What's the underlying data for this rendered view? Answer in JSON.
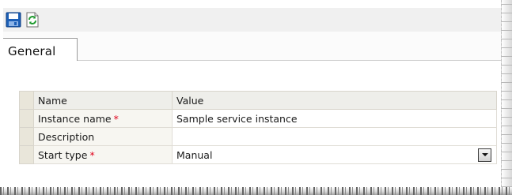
{
  "toolbar": {
    "buttons": [
      {
        "icon": "save-icon"
      },
      {
        "icon": "refresh-icon"
      }
    ]
  },
  "tabs": [
    {
      "label": "General",
      "selected": true
    }
  ],
  "grid": {
    "headers": {
      "name": "Name",
      "value": "Value"
    },
    "rows": [
      {
        "name": "Instance name",
        "required": true,
        "value": "Sample service instance"
      },
      {
        "name": "Description",
        "required": false,
        "value": ""
      },
      {
        "name": "Start type",
        "required": true,
        "value": "Manual",
        "control": "dropdown"
      }
    ],
    "required_marker": "*"
  },
  "colors": {
    "required_marker": "#e0001b",
    "gutter": "#e9e6da",
    "header_bg": "#eeeeea",
    "toolbar_bg": "#f0f0f0"
  }
}
